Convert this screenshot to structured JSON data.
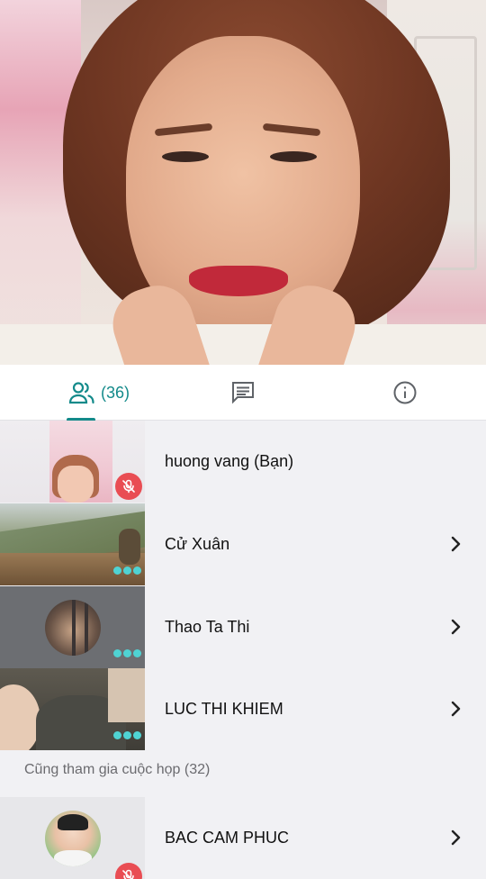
{
  "tabs": {
    "participants_count": "(36)"
  },
  "participants": [
    {
      "name": "huong vang (Bạn)"
    },
    {
      "name": "Cử Xuân"
    },
    {
      "name": "Thao Ta Thi"
    },
    {
      "name": "LUC THI KHIEM"
    }
  ],
  "also_joined": {
    "header": "Cũng tham gia cuộc họp (32)",
    "items": [
      {
        "name": "BAC CAM PHUC"
      }
    ]
  },
  "colors": {
    "accent": "#138a8a",
    "mic_off": "#e94d53",
    "speaking_dots": "#4fd3d3"
  }
}
